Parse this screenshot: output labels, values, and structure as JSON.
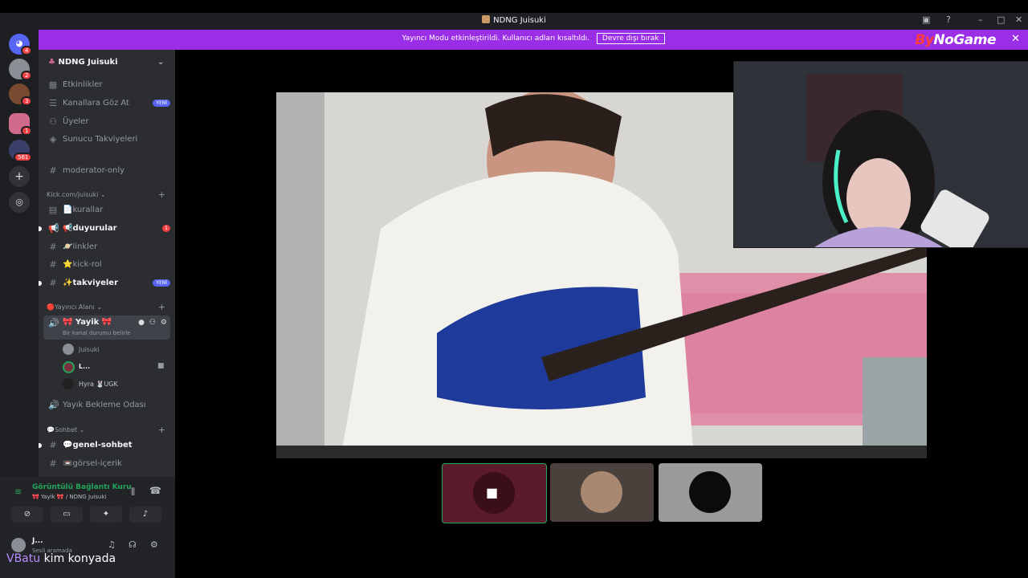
{
  "window": {
    "title": "NDNG Juisuki"
  },
  "banner": {
    "message": "Yayıncı Modu etkinleştirildi. Kullanıcı adları kısaltıldı.",
    "button": "Devre dışı bırak",
    "logo_a": "By",
    "logo_b": "NoGame"
  },
  "rail": {
    "badges": [
      "4",
      "2",
      "3",
      "1",
      "561"
    ]
  },
  "server": {
    "name": "NDNG Juisuki"
  },
  "nav": [
    {
      "label": "Etkinlikler",
      "icon": "calendar-icon"
    },
    {
      "label": "Kanallara Göz At",
      "icon": "browse-icon",
      "badge": "YENİ"
    },
    {
      "label": "Üyeler",
      "icon": "members-icon"
    },
    {
      "label": "Sunucu Takviyeleri",
      "icon": "boost-icon"
    }
  ],
  "channels_top": [
    {
      "label": "moderator-only"
    }
  ],
  "category1": {
    "name": "Kick.com/juisuki"
  },
  "channels1": [
    {
      "label": "📄kurallar",
      "icon": "rules-icon"
    },
    {
      "label": "📢duyurular",
      "icon": "announcement-icon",
      "unread": "1"
    },
    {
      "label": "🪐linkler",
      "icon": "hash-icon"
    },
    {
      "label": "⭐kick-rol",
      "icon": "hash-icon"
    },
    {
      "label": "✨takviyeler",
      "icon": "hash-icon",
      "badge": "YENİ"
    }
  ],
  "category2": {
    "name": "🔴Yayıncı Alanı"
  },
  "voice": {
    "name": "🎀 Yayik 🎀",
    "status": "Bir kanal durumu belirle",
    "users": [
      "Juisuki",
      "L...",
      "Hyra 🐰UGK"
    ]
  },
  "voice2": {
    "label": "Yayık Bekleme Odası"
  },
  "category3": {
    "name": "💬Sohbet"
  },
  "channels3": [
    {
      "label": "💬genel-sohbet",
      "bold": true
    },
    {
      "label": "📼görsel-içerik"
    }
  ],
  "panel": {
    "connection": "Görüntülü Bağlantı Kuru",
    "location": "🎀 Yayik 🎀 / NDNG Juisuki",
    "user": "J...",
    "user_status": "Sesli aramada"
  },
  "overlay": {
    "user": "VBatu",
    "message": "kim konyada"
  },
  "colors": {
    "accent": "#9a2ee6",
    "rail": "#1e1f22",
    "sidebar": "#2b2d31",
    "online": "#23a559"
  }
}
